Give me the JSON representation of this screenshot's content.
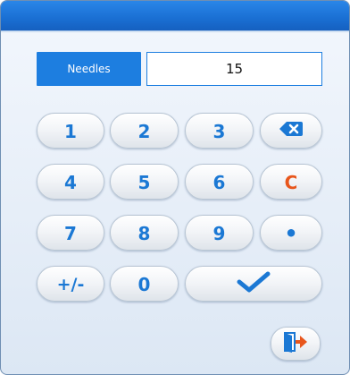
{
  "field": {
    "label": "Needles",
    "value": "15"
  },
  "keypad": {
    "row1": [
      "1",
      "2",
      "3"
    ],
    "row2": [
      "4",
      "5",
      "6"
    ],
    "row3": [
      "7",
      "8",
      "9"
    ],
    "sign": "+/-",
    "zero": "0",
    "clear": "C",
    "dot": "•"
  },
  "icons": {
    "backspace": "backspace-icon",
    "confirm": "checkmark-icon",
    "exit": "exit-door-icon"
  },
  "colors": {
    "accent": "#1d7ee0",
    "titlebar": "#1a6fd3",
    "key_text": "#1b78d4",
    "clear_text": "#e8561c",
    "exit_arrow": "#e8561c"
  }
}
